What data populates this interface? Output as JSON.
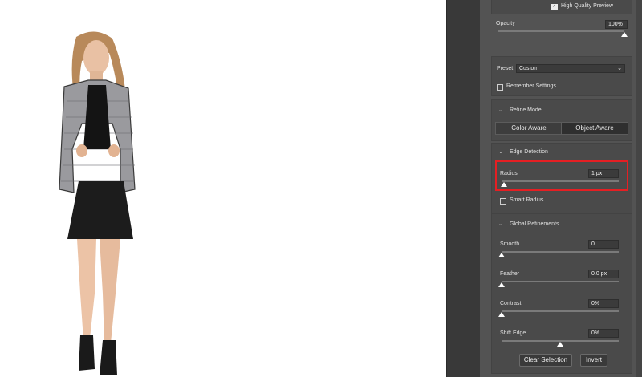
{
  "preview": {
    "high_quality_label": "High Quality Preview",
    "checked": true
  },
  "opacity": {
    "label": "Opacity",
    "value": "100%",
    "level": 1.0
  },
  "preset": {
    "label": "Preset",
    "value": "Custom"
  },
  "remember": {
    "label": "Remember Settings",
    "checked": false
  },
  "refine_mode": {
    "header": "Refine Mode",
    "options": [
      "Color Aware",
      "Object Aware"
    ],
    "selected": "Object Aware"
  },
  "edge_detection": {
    "header": "Edge Detection",
    "radius_label": "Radius",
    "radius_value": "1 px",
    "radius_level": 0.02,
    "smart_radius_label": "Smart Radius",
    "smart_radius_checked": false
  },
  "global_refinements": {
    "header": "Global Refinements",
    "smooth_label": "Smooth",
    "smooth_value": "0",
    "smooth_level": 0.0,
    "feather_label": "Feather",
    "feather_value": "0.0 px",
    "feather_level": 0.0,
    "contrast_label": "Contrast",
    "contrast_value": "0%",
    "contrast_level": 0.0,
    "shift_label": "Shift Edge",
    "shift_value": "0%",
    "shift_level": 0.5
  },
  "actions": {
    "clear_selection": "Clear Selection",
    "invert": "Invert"
  },
  "colors": {
    "panel": "#535353",
    "highlight": "#e51f23",
    "canvas": "#ffffff"
  },
  "icons": {
    "chevron": "chevron-down-icon",
    "checkbox": "checkbox-icon",
    "dropdown": "dropdown-arrow-icon"
  }
}
